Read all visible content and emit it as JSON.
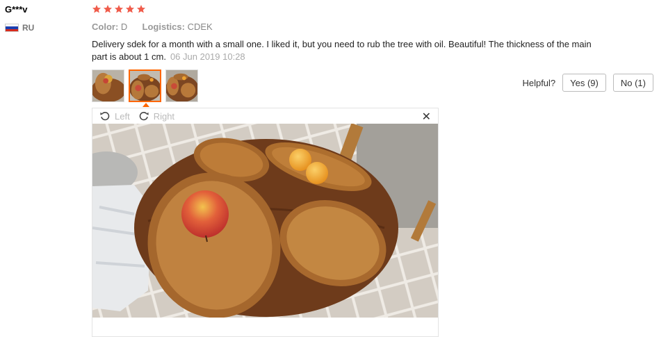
{
  "reviewer": {
    "name": "G***v",
    "country": "RU"
  },
  "rating": {
    "stars": 5,
    "max": 5,
    "color": "#f05b4a"
  },
  "attributes": {
    "color_key": "Color:",
    "color_value": "D",
    "logistics_key": "Logistics:",
    "logistics_value": "CDEK"
  },
  "review": {
    "text": "Delivery sdek for a month with a small one. I liked it, but you need to rub the tree with oil. Beautiful! The thickness of the main part is about 1 cm.",
    "date": "06 Jun 2019 10:28"
  },
  "thumbnails": {
    "count": 3,
    "active_index": 1
  },
  "helpful": {
    "label": "Helpful?",
    "yes": "Yes (9)",
    "no": "No (1)"
  },
  "viewer": {
    "rotate_left": "Left",
    "rotate_right": "Right",
    "close_icon": "close-icon",
    "left_icon": "rotate-left-icon",
    "right_icon": "rotate-right-icon"
  },
  "colors": {
    "accent": "#ff6600",
    "text": "#222222",
    "muted": "#888888"
  }
}
